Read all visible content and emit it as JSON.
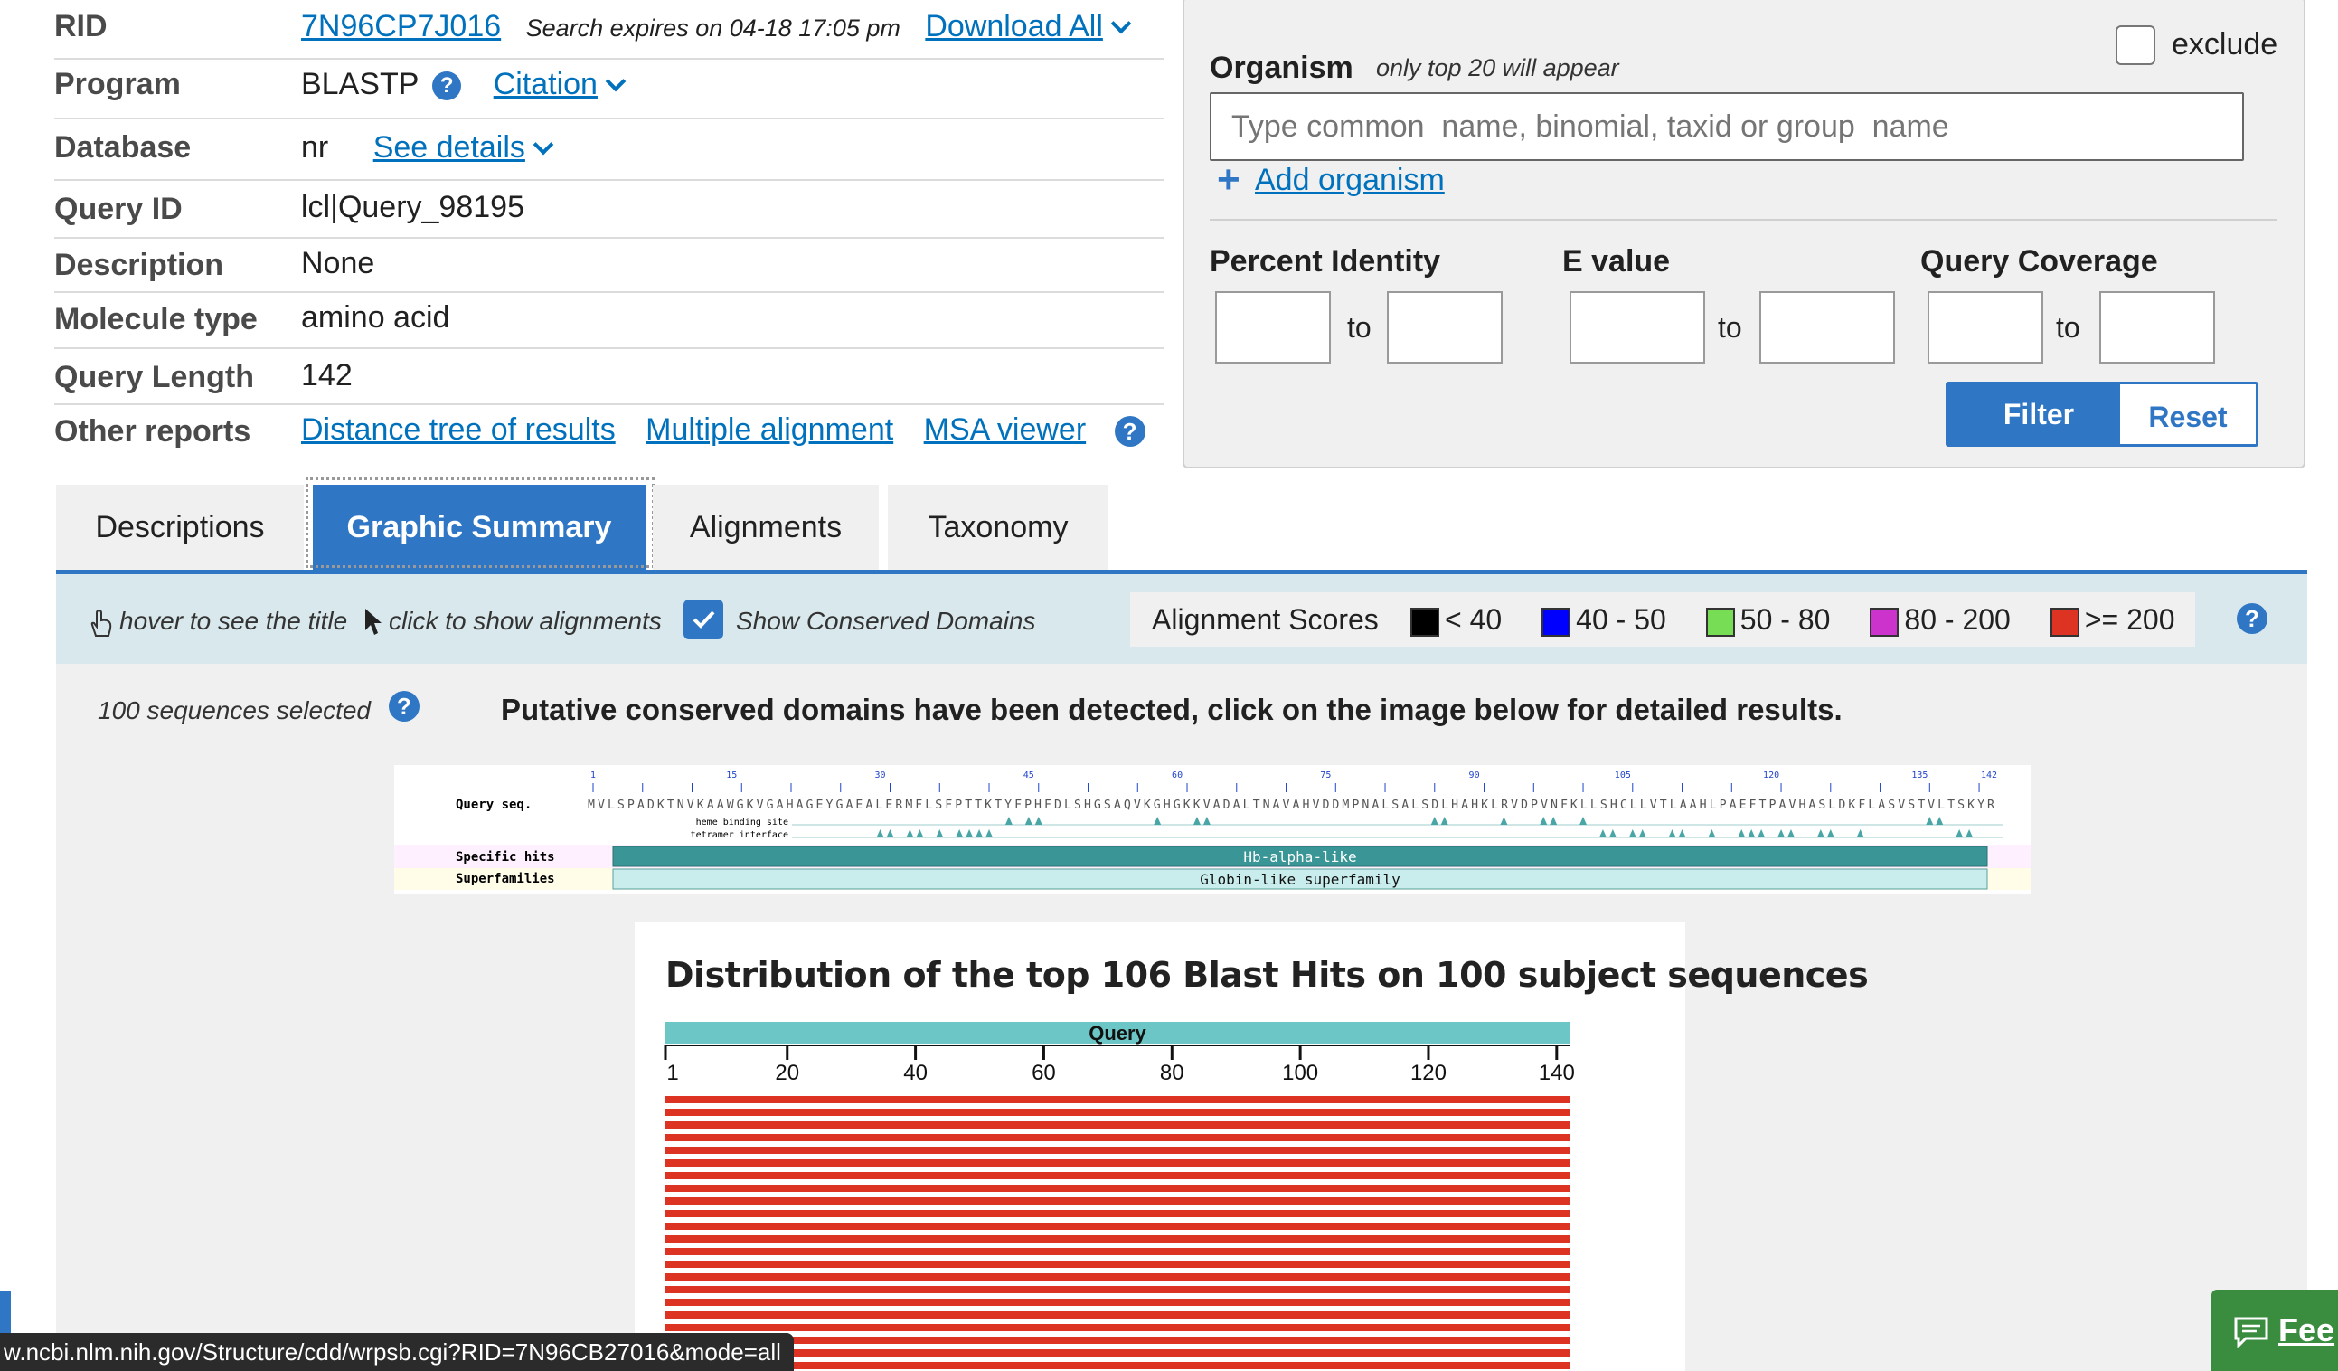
{
  "summary": {
    "rid_label": "RID",
    "rid_value": "7N96CP7J016",
    "search_expires": "Search expires on 04-18 17:05 pm",
    "download_all": "Download All",
    "program_label": "Program",
    "program_value": "BLASTP",
    "citation": "Citation",
    "database_label": "Database",
    "database_value": "nr",
    "see_details": "See details",
    "query_id_label": "Query ID",
    "query_id_value": "lcl|Query_98195",
    "description_label": "Description",
    "description_value": "None",
    "molecule_type_label": "Molecule type",
    "molecule_type_value": "amino acid",
    "query_length_label": "Query Length",
    "query_length_value": "142",
    "other_reports_label": "Other reports",
    "distance_tree": "Distance tree of results",
    "multiple_alignment": "Multiple alignment",
    "msa_viewer": "MSA viewer"
  },
  "filter": {
    "exclude_label": "exclude",
    "organism_label": "Organism",
    "organism_note": "only top 20 will appear",
    "organism_placeholder": "Type common  name, binomial, taxid or group  name",
    "add_organism": "Add organism",
    "percent_identity_label": "Percent Identity",
    "evalue_label": "E value",
    "query_coverage_label": "Query Coverage",
    "to_label": "to",
    "filter_button": "Filter",
    "reset_button": "Reset"
  },
  "tabs": [
    "Descriptions",
    "Graphic Summary",
    "Alignments",
    "Taxonomy"
  ],
  "graphic_summary": {
    "hover_hint": "hover to see the title",
    "click_hint": "click to show alignments",
    "show_conserved_domains": "Show Conserved Domains",
    "alignment_scores_label": "Alignment Scores",
    "score_ranges": [
      {
        "label": "< 40",
        "color": "#000000"
      },
      {
        "label": "40 - 50",
        "color": "#0000ff"
      },
      {
        "label": "50 - 80",
        "color": "#77dd55"
      },
      {
        "label": "80 - 200",
        "color": "#cc33cc"
      },
      {
        "label": ">= 200",
        "color": "#dd3322"
      }
    ],
    "sequences_selected": "100 sequences selected",
    "conserved_msg": "Putative conserved domains have been detected, click on the image below for detailed results."
  },
  "cdd": {
    "query_seq_label": "Query seq.",
    "specific_hits_label": "Specific hits",
    "superfamilies_label": "Superfamilies",
    "sequence": "MVLSPADKTNVKAAWGKVGAHAGEYGAEALERMFLSFPTTKTYFPHFDLSHGSAQVKGHGKKVADALTNAVAHVDDMPNALSALSDLHAHKLRVDPVNFKLLSHCLLVTLAAHLPAEFTPAVHASLDKFLASVSTVLTSKYR",
    "ticks": [
      "1",
      "15",
      "30",
      "45",
      "60",
      "75",
      "90",
      "105",
      "120",
      "135",
      "142"
    ],
    "heme_binding_site": "heme binding site",
    "tetramer_interface": "tetramer interface",
    "specific_hit": "Hb-alpha-like",
    "superfamily": "Globin-like superfamily"
  },
  "distribution": {
    "title": "Distribution of the top 106 Blast Hits on 100 subject sequences",
    "query_label": "Query",
    "axis_ticks": [
      "1",
      "20",
      "40",
      "60",
      "80",
      "100",
      "120",
      "140"
    ],
    "hit_color": "#dd3322"
  },
  "status_url": "w.ncbi.nlm.nih.gov/Structure/cdd/wrpsb.cgi?RID=7N96CB27016&mode=all",
  "feedback_label": "Fee"
}
